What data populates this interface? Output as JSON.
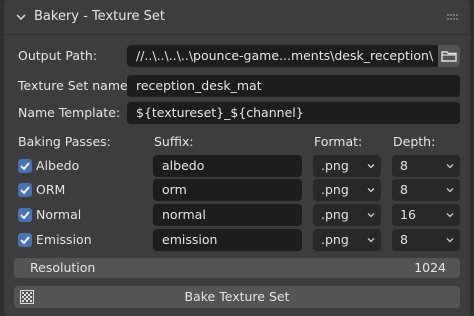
{
  "panel": {
    "title": "Bakery - Texture Set"
  },
  "output_path": {
    "label": "Output Path:",
    "value": "//..\\..\\..\\..\\pounce-game...ments\\desk_reception\\"
  },
  "texture_set_name": {
    "label": "Texture Set name:",
    "value": "reception_desk_mat"
  },
  "name_template": {
    "label": "Name Template:",
    "value": "${textureset}_${channel}"
  },
  "columns": {
    "passes": "Baking Passes:",
    "suffix": "Suffix:",
    "format": "Format:",
    "depth": "Depth:"
  },
  "passes": [
    {
      "name": "Albedo",
      "enabled": true,
      "suffix": "albedo",
      "format": ".png",
      "depth": "8"
    },
    {
      "name": "ORM",
      "enabled": true,
      "suffix": "orm",
      "format": ".png",
      "depth": "8"
    },
    {
      "name": "Normal",
      "enabled": true,
      "suffix": "normal",
      "format": ".png",
      "depth": "16"
    },
    {
      "name": "Emission",
      "enabled": true,
      "suffix": "emission",
      "format": ".png",
      "depth": "8"
    }
  ],
  "resolution": {
    "label": "Resolution",
    "value": "1024"
  },
  "bake_button": {
    "label": "Bake Texture Set"
  },
  "colors": {
    "checkbox": "#4772b3",
    "field": "#1d1d1d",
    "button": "#545454"
  },
  "icons": {
    "collapse": "chevron-down-icon",
    "grip": "drag-grip-icon",
    "folder": "folder-icon",
    "bake": "checker-texture-icon",
    "check": "checkmark-icon",
    "dropdown": "chevron-down-icon"
  }
}
